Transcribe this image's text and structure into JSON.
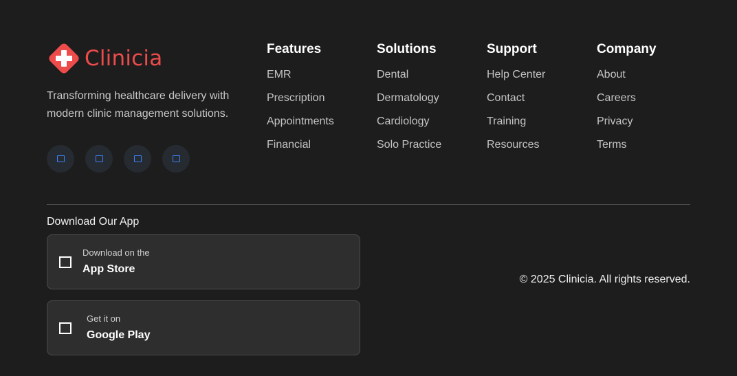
{
  "brand": {
    "name": "Clinicia",
    "color": "#ee4b4b",
    "tagline": "Transforming healthcare delivery with modern clinic management solutions.",
    "logo_icon": "medical-cross-icon",
    "social_icons": [
      "social-icon-1",
      "social-icon-2",
      "social-icon-3",
      "social-icon-4"
    ],
    "social_accent": "#3b82f6"
  },
  "columns": [
    {
      "title": "Features",
      "links": [
        "EMR",
        "Prescription",
        "Appointments",
        "Financial"
      ]
    },
    {
      "title": "Solutions",
      "links": [
        "Dental",
        "Dermatology",
        "Cardiology",
        "Solo Practice"
      ]
    },
    {
      "title": "Support",
      "links": [
        "Help Center",
        "Contact",
        "Training",
        "Resources"
      ]
    },
    {
      "title": "Company",
      "links": [
        "About",
        "Careers",
        "Privacy",
        "Terms"
      ]
    }
  ],
  "download": {
    "title": "Download Our App",
    "app_store": {
      "small": "Download on the",
      "big": "App Store"
    },
    "google_play": {
      "small": "Get it on",
      "big": "Google Play"
    }
  },
  "copyright": "© 2025 Clinicia. All rights reserved."
}
